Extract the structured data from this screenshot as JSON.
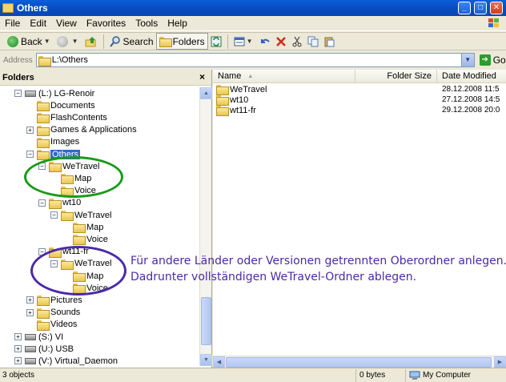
{
  "window": {
    "title": "Others"
  },
  "title_buttons": {
    "minimize": "_",
    "maximize": "□",
    "close": "✕"
  },
  "menu": [
    "File",
    "Edit",
    "View",
    "Favorites",
    "Tools",
    "Help"
  ],
  "toolbar": {
    "back": "Back",
    "search": "Search",
    "folders": "Folders"
  },
  "address": {
    "label": "Address",
    "value": "L:\\Others",
    "go": "Go"
  },
  "left_pane": {
    "title": "Folders",
    "close": "×",
    "tree": [
      {
        "label": "(L:) LG-Renoir",
        "toggle": "−",
        "kind": "drive"
      },
      {
        "label": "Documents",
        "toggle": "",
        "kind": "folder"
      },
      {
        "label": "FlashContents",
        "toggle": "",
        "kind": "folder"
      },
      {
        "label": "Games & Applications",
        "toggle": "+",
        "kind": "folder"
      },
      {
        "label": "Images",
        "toggle": "",
        "kind": "folder"
      },
      {
        "label": "Others",
        "toggle": "−",
        "kind": "folder",
        "selected": true
      },
      {
        "label": "WeTravel",
        "toggle": "−",
        "kind": "folder"
      },
      {
        "label": "Map",
        "toggle": "",
        "kind": "folder"
      },
      {
        "label": "Voice",
        "toggle": "",
        "kind": "folder"
      },
      {
        "label": "wt10",
        "toggle": "−",
        "kind": "folder"
      },
      {
        "label": "WeTravel",
        "toggle": "−",
        "kind": "folder"
      },
      {
        "label": "Map",
        "toggle": "",
        "kind": "folder"
      },
      {
        "label": "Voice",
        "toggle": "",
        "kind": "folder"
      },
      {
        "label": "wt11-fr",
        "toggle": "−",
        "kind": "folder"
      },
      {
        "label": "WeTravel",
        "toggle": "−",
        "kind": "folder"
      },
      {
        "label": "Map",
        "toggle": "",
        "kind": "folder"
      },
      {
        "label": "Voice",
        "toggle": "",
        "kind": "folder"
      },
      {
        "label": "Pictures",
        "toggle": "+",
        "kind": "folder"
      },
      {
        "label": "Sounds",
        "toggle": "+",
        "kind": "folder"
      },
      {
        "label": "Videos",
        "toggle": "",
        "kind": "folder"
      },
      {
        "label": "(S:) VI",
        "toggle": "+",
        "kind": "drive"
      },
      {
        "label": "(U:) USB",
        "toggle": "+",
        "kind": "drive"
      },
      {
        "label": "(V:) Virtual_Daemon",
        "toggle": "+",
        "kind": "drive"
      }
    ]
  },
  "file_list": {
    "columns": {
      "name": "Name",
      "size": "Folder Size",
      "date": "Date Modified"
    },
    "rows": [
      {
        "name": "WeTravel",
        "size": "",
        "date": "28.12.2008 11:5"
      },
      {
        "name": "wt10",
        "size": "",
        "date": "27.12.2008 14:5"
      },
      {
        "name": "wt11-fr",
        "size": "",
        "date": "29.12.2008 20:0"
      }
    ]
  },
  "annotation": {
    "line1": "Für andere Länder oder Versionen getrennten Oberordner anlegen.",
    "line2": "Dadrunter vollständigen WeTravel-Ordner ablegen.",
    "color": "#4a2aa8",
    "ellipse_colors": [
      "#1a9a1a",
      "#4a2aa8"
    ]
  },
  "status": {
    "objects": "3 objects",
    "size": "0 bytes",
    "location": "My Computer"
  }
}
